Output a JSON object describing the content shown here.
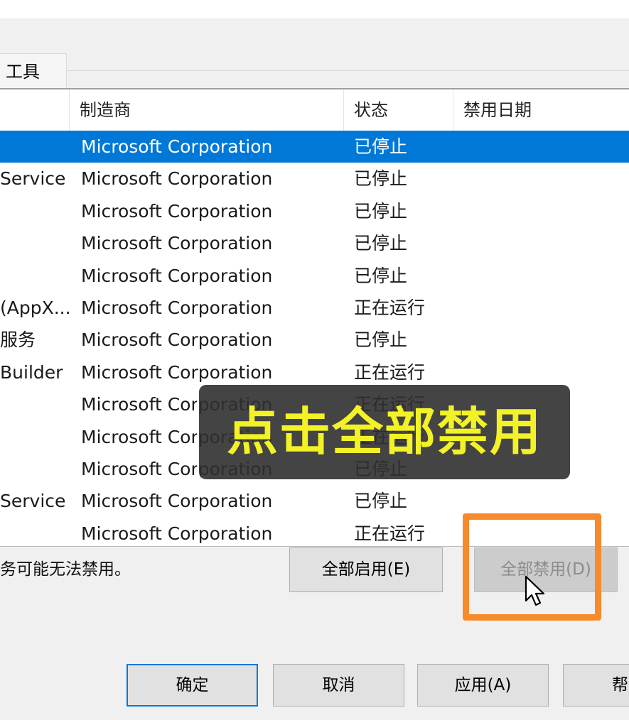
{
  "tabs": [
    {
      "label": "工具"
    }
  ],
  "columns": {
    "maker": "制造商",
    "status": "状态",
    "disabled_date": "禁用日期"
  },
  "rows": [
    {
      "name": "",
      "maker": "Microsoft Corporation",
      "status": "已停止",
      "selected": true
    },
    {
      "name": "Service",
      "maker": "Microsoft Corporation",
      "status": "已停止"
    },
    {
      "name": "",
      "maker": "Microsoft Corporation",
      "status": "已停止"
    },
    {
      "name": "",
      "maker": "Microsoft Corporation",
      "status": "已停止"
    },
    {
      "name": "",
      "maker": "Microsoft Corporation",
      "status": "已停止"
    },
    {
      "name": "(AppX...",
      "maker": "Microsoft Corporation",
      "status": "正在运行"
    },
    {
      "name": "服务",
      "maker": "Microsoft Corporation",
      "status": "已停止"
    },
    {
      "name": "Builder",
      "maker": "Microsoft Corporation",
      "status": "正在运行"
    },
    {
      "name": "",
      "maker": "Microsoft Corporation",
      "status": "正在运行"
    },
    {
      "name": "",
      "maker": "Microsoft Corporation",
      "status": "正在运行"
    },
    {
      "name": "",
      "maker": "Microsoft Corporation",
      "status": "已停止"
    },
    {
      "name": "Service",
      "maker": "Microsoft Corporation",
      "status": "已停止"
    },
    {
      "name": "",
      "maker": "Microsoft Corporation",
      "status": "正在运行"
    }
  ],
  "note": "务可能无法禁用。",
  "buttons": {
    "enable_all": "全部启用(E)",
    "disable_all": "全部禁用(D)",
    "ok": "确定",
    "cancel": "取消",
    "apply": "应用(A)",
    "help": "帮"
  },
  "overlay_caption": "点击全部禁用",
  "colors": {
    "selection": "#0078d7",
    "caption": "#f2f227",
    "highlight": "#f78a2a"
  },
  "icons": {
    "cursor": "arrow-cursor-icon"
  }
}
